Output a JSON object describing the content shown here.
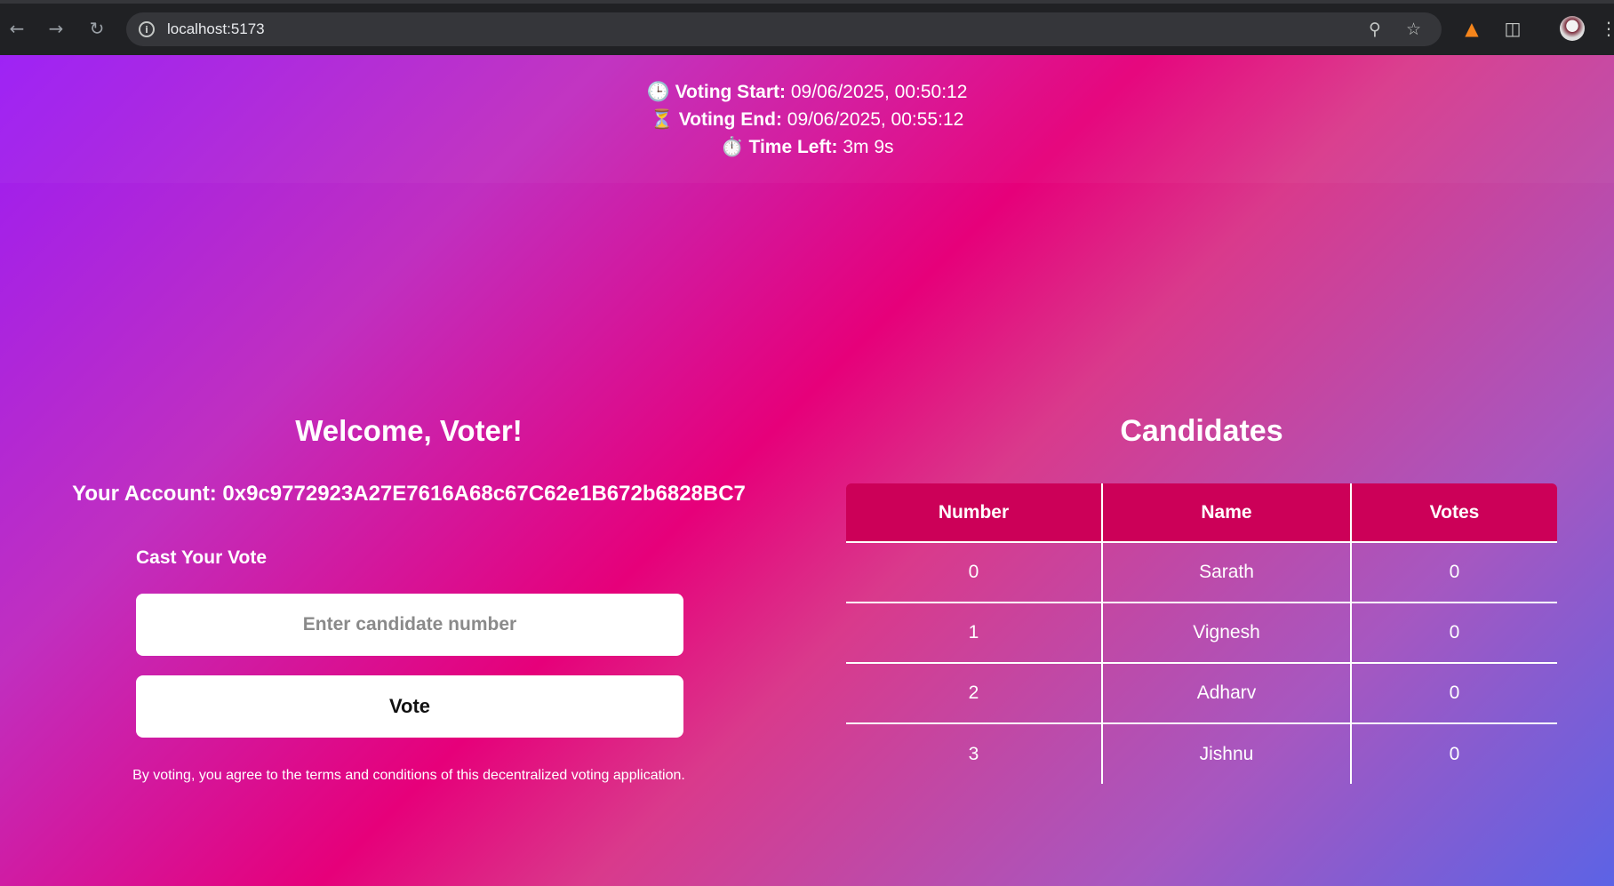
{
  "browser": {
    "url": "localhost:5173",
    "back_icon": "arrow-left-icon",
    "forward_icon": "arrow-right-icon",
    "reload_icon": "reload-icon",
    "site_info_icon": "info-icon",
    "zoom_icon": "zoom-icon",
    "bookmark_icon": "star-icon",
    "extension_icons": [
      "metamask-fox-icon",
      "puzzle-extensions-icon"
    ],
    "menu_icon": "kebab-menu-icon"
  },
  "timer": {
    "start_icon": "🕒",
    "start_label": "Voting Start:",
    "start_value": "09/06/2025, 00:50:12",
    "end_icon": "⏳",
    "end_label": "Voting End:",
    "end_value": "09/06/2025, 00:55:12",
    "left_icon": "⏱️",
    "left_label": "Time Left:",
    "left_value": "3m 9s"
  },
  "voter": {
    "welcome": "Welcome, Voter!",
    "account": "Your Account: 0x9c9772923A27E7616A68c67C62e1B672b6828BC7",
    "cast_label": "Cast Your Vote",
    "input_placeholder": "Enter candidate number",
    "vote_button": "Vote",
    "terms": "By voting, you agree to the terms and conditions of this decentralized voting application."
  },
  "candidates": {
    "title": "Candidates",
    "columns": [
      "Number",
      "Name",
      "Votes"
    ],
    "rows": [
      {
        "number": "0",
        "name": "Sarath",
        "votes": "0"
      },
      {
        "number": "1",
        "name": "Vignesh",
        "votes": "0"
      },
      {
        "number": "2",
        "name": "Adharv",
        "votes": "0"
      },
      {
        "number": "3",
        "name": "Jishnu",
        "votes": "0"
      }
    ]
  },
  "colors": {
    "header_cell": "#cc0058",
    "gradient_start": "#9b1cf5",
    "gradient_mid": "#e6007a",
    "gradient_end": "#5c63e5"
  }
}
